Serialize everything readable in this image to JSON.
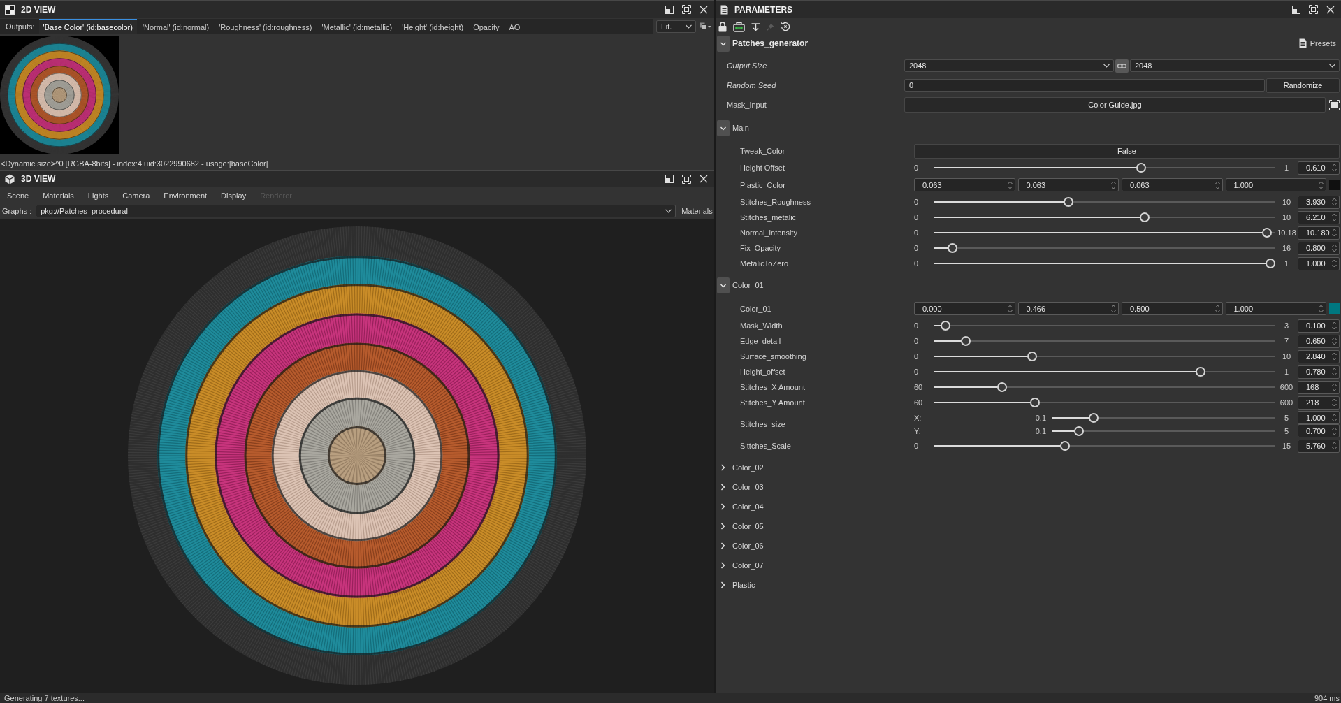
{
  "view_2d": {
    "title": "2D VIEW",
    "outputs_label": "Outputs:",
    "outputs": [
      {
        "label": "'Base Color' (id:basecolor)",
        "selected": true
      },
      {
        "label": "'Normal' (id:normal)",
        "selected": false
      },
      {
        "label": "'Roughness' (id:roughness)",
        "selected": false
      },
      {
        "label": "'Metallic' (id:metallic)",
        "selected": false
      },
      {
        "label": "'Height' (id:height)",
        "selected": false
      },
      {
        "label": "Opacity",
        "selected": false
      },
      {
        "label": "AO",
        "selected": false
      }
    ],
    "zoom": "Fit.",
    "info": "<Dynamic size>^0 [RGBA-8bits] - index:4 uid:3022990682 - usage:|baseColor|"
  },
  "view_3d": {
    "title": "3D VIEW",
    "menu": [
      {
        "label": "Scene",
        "disabled": false
      },
      {
        "label": "Materials",
        "disabled": false
      },
      {
        "label": "Lights",
        "disabled": false
      },
      {
        "label": "Camera",
        "disabled": false
      },
      {
        "label": "Environment",
        "disabled": false
      },
      {
        "label": "Display",
        "disabled": false
      },
      {
        "label": "Renderer",
        "disabled": true
      }
    ],
    "graphs_label": "Graphs :",
    "graph": "pkg://Patches_procedural",
    "materials": "Materials"
  },
  "parameters": {
    "title": "PARAMETERS",
    "toolbar": [
      {
        "kind": "lock",
        "disabled": false
      },
      {
        "kind": "sync",
        "disabled": false
      },
      {
        "kind": "insert",
        "disabled": false
      },
      {
        "kind": "pin",
        "disabled": true
      },
      {
        "kind": "reset",
        "disabled": false
      }
    ],
    "graph": {
      "title": "Patches_generator",
      "expanded": true,
      "presets": "Presets",
      "fields": [
        {
          "kind": "size",
          "label": "Output Size",
          "system": true,
          "values": [
            "2048",
            "2048"
          ],
          "linked": true
        },
        {
          "kind": "seed",
          "label": "Random Seed",
          "system": true,
          "value": "0",
          "button": "Randomize"
        },
        {
          "kind": "file",
          "label": "Mask_Input",
          "system": false,
          "value": "Color Guide.jpg"
        }
      ],
      "groups": [
        {
          "label": "Main",
          "expanded": true,
          "params": [
            {
              "kind": "button",
              "label": "Tweak_Color",
              "value": "False"
            },
            {
              "kind": "slider",
              "label": "Height Offset",
              "min": "0",
              "max": "1",
              "level": 0.61,
              "value": "0.610"
            },
            {
              "kind": "color",
              "label": "Plastic_Color",
              "values": [
                "0.063",
                "0.063",
                "0.063",
                "1.000"
              ],
              "color": "#101010"
            },
            {
              "kind": "slider",
              "label": "Stitches_Roughness",
              "min": "0",
              "max": "10",
              "level": 0.39,
              "value": "3.930"
            },
            {
              "kind": "slider",
              "label": "Stitches_metalic",
              "min": "0",
              "max": "10",
              "level": 0.62,
              "value": "6.210"
            },
            {
              "kind": "slider",
              "label": "Normal_intensity",
              "min": "0",
              "max": "10.18",
              "level": 0.99,
              "value": "10.180"
            },
            {
              "kind": "slider",
              "label": "Fix_Opacity",
              "min": "0",
              "max": "16",
              "level": 0.04,
              "value": "0.800"
            },
            {
              "kind": "slider",
              "label": "MetalicToZero",
              "min": "0",
              "max": "1",
              "level": 1,
              "value": "1.000"
            }
          ]
        },
        {
          "label": "Color_01",
          "expanded": true,
          "params": [
            {
              "kind": "color",
              "label": "Color_01",
              "values": [
                "0.000",
                "0.466",
                "0.500",
                "1.000"
              ],
              "color": "#007780"
            },
            {
              "kind": "slider",
              "label": "Mask_Width",
              "min": "0",
              "max": "3",
              "level": 0.02,
              "value": "0.100"
            },
            {
              "kind": "slider",
              "label": "Edge_detail",
              "min": "0",
              "max": "7",
              "level": 0.08,
              "value": "0.650"
            },
            {
              "kind": "slider",
              "label": "Surface_smoothing",
              "min": "0",
              "max": "10",
              "level": 0.28,
              "value": "2.840"
            },
            {
              "kind": "slider",
              "label": "Height_offset",
              "min": "0",
              "max": "1",
              "level": 0.79,
              "value": "0.780"
            },
            {
              "kind": "slider",
              "label": "Stitches_X Amount",
              "min": "60",
              "max": "600",
              "level": 0.19,
              "value": "168"
            },
            {
              "kind": "slider",
              "label": "Stitches_Y Amount",
              "min": "60",
              "max": "600",
              "level": 0.29,
              "value": "218"
            },
            {
              "kind": "vector",
              "label": "Stitches_size",
              "axes": [
                {
                  "axis": "X:",
                  "min": "0.1",
                  "max": "5",
                  "level": 0.17,
                  "value": "1.000"
                },
                {
                  "axis": "Y:",
                  "min": "0.1",
                  "max": "5",
                  "level": 0.1,
                  "value": "0.700"
                }
              ]
            },
            {
              "kind": "slider",
              "label": "Sittches_Scale",
              "min": "0",
              "max": "15",
              "level": 0.38,
              "value": "5.760"
            }
          ]
        },
        {
          "label": "Color_02",
          "expanded": false
        },
        {
          "label": "Color_03",
          "expanded": false
        },
        {
          "label": "Color_04",
          "expanded": false
        },
        {
          "label": "Color_05",
          "expanded": false
        },
        {
          "label": "Color_06",
          "expanded": false
        },
        {
          "label": "Color_07",
          "expanded": false
        },
        {
          "label": "Plastic",
          "expanded": false
        }
      ]
    }
  },
  "status_bar": {
    "message": "Generating 7 textures...",
    "time": "904 ms"
  }
}
